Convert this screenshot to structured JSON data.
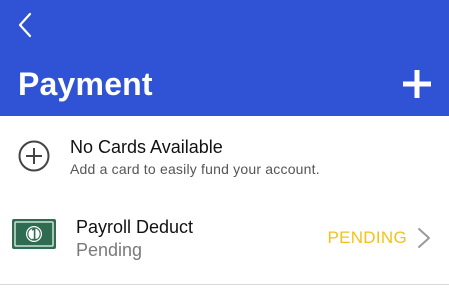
{
  "header": {
    "title": "Payment"
  },
  "icons": {
    "back": "chevron-left-icon",
    "add": "plus-icon",
    "add_card": "plus-circle-icon",
    "payroll": "money-bill-icon",
    "row_nav": "chevron-right-icon"
  },
  "colors": {
    "header_bg": "#2f53d4",
    "status_pending": "#f2c21b",
    "bill_green": "#2e6b50"
  },
  "no_cards": {
    "title": "No Cards Available",
    "subtitle": "Add a card to easily fund your account."
  },
  "payroll": {
    "title": "Payroll Deduct",
    "subtitle": "Pending",
    "status": "PENDING"
  }
}
